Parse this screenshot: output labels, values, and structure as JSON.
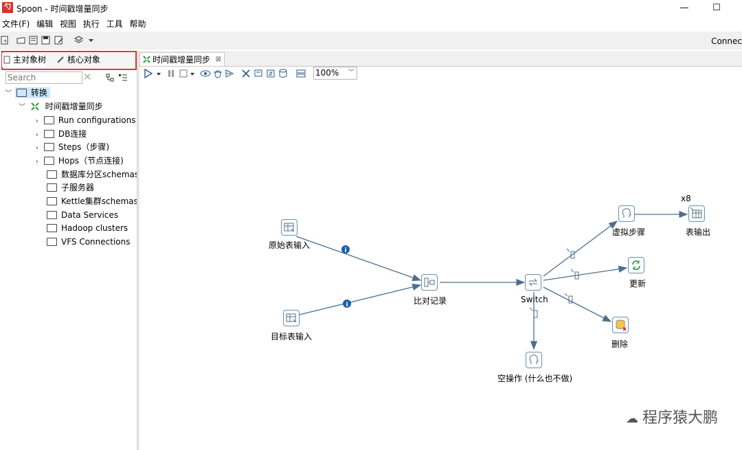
{
  "window": {
    "title": "Spoon - 时间戳增量同步",
    "app_icon": "spoon-icon"
  },
  "menu": [
    "文件(F)",
    "编辑",
    "视图",
    "执行",
    "工具",
    "帮助"
  ],
  "toolbar": {
    "connect_label": "Connec"
  },
  "left": {
    "tabs": [
      "主对象树",
      "核心对象"
    ],
    "search_placeholder": "Search",
    "tree": {
      "root": "转换",
      "transform": "时间戳增量同步",
      "items": [
        "Run configurations",
        "DB连接",
        "Steps（步骤)",
        "Hops（节点连接)",
        "数据库分区schemas",
        "子服务器",
        "Kettle集群schemas",
        "Data Services",
        "Hadoop clusters",
        "VFS Connections"
      ]
    }
  },
  "editor": {
    "tab_label": "时间戳增量同步",
    "zoom": "100%"
  },
  "canvas": {
    "steps": {
      "src_input": "原始表输入",
      "tgt_input": "目标表输入",
      "compare": "比对记录",
      "switch": "Switch",
      "dummy": "虚拟步骤",
      "table_out": "表输出",
      "update": "更新",
      "delete": "删除",
      "noop": "空操作 (什么也不做)"
    },
    "copies": "x8"
  },
  "watermark": "程序猿大鹏"
}
